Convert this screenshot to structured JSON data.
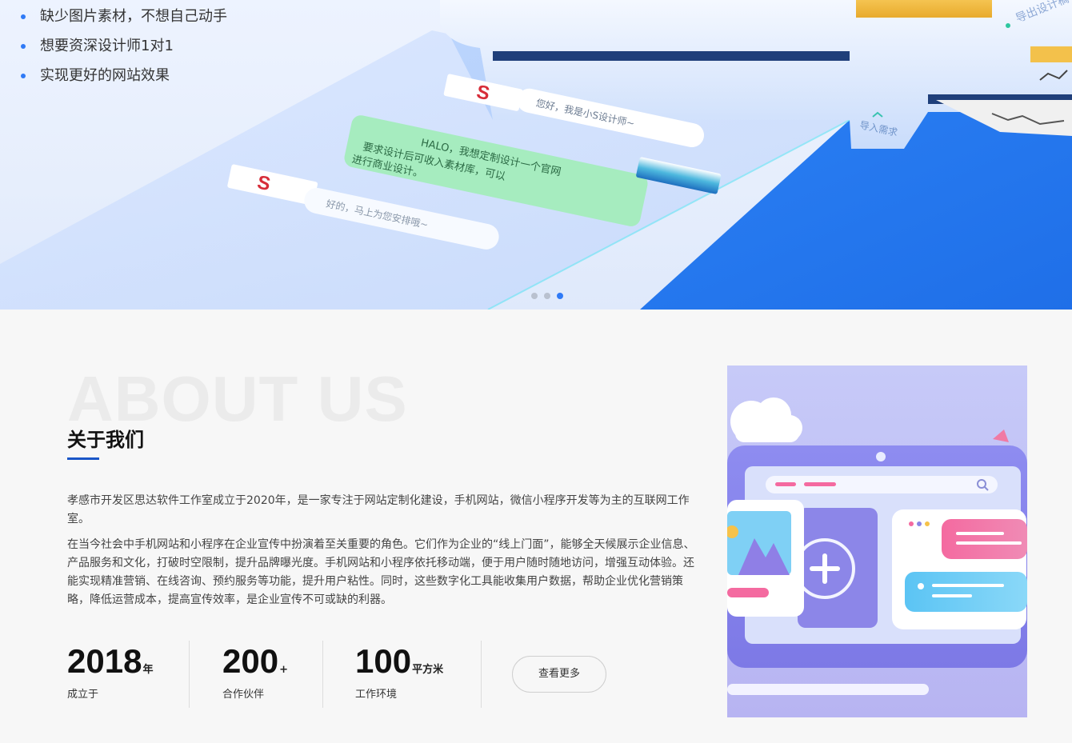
{
  "hero": {
    "bullets": [
      "缺少图片素材，不想自己动手",
      "想要资深设计师1对1",
      "实现更好的网站效果"
    ],
    "printer_import_label": "导入需求",
    "printer_export_label": "导出设计稿",
    "chat_bubble_1": "您好，我是小S设计师~",
    "chat_bubble_2": "HALO，我想定制设计一个官网 要求设计后可收入素材库，可以 进行商业设计。",
    "chat_bubble_3": "好的，马上为您安排哦~",
    "logo_letter": "S",
    "dots": [
      {
        "active": false
      },
      {
        "active": false
      },
      {
        "active": true
      }
    ]
  },
  "about": {
    "watermark": "ABOUT US",
    "title": "关于我们",
    "paragraph_1": "孝感市开发区思达软件工作室成立于2020年，是一家专注于网站定制化建设，手机网站，微信小程序开发等为主的互联网工作室。",
    "paragraph_2": "在当今社会中手机网站和小程序在企业宣传中扮演着至关重要的角色。它们作为企业的“线上门面”，能够全天候展示企业信息、产品服务和文化，打破时空限制，提升品牌曝光度。手机网站和小程序依托移动端，便于用户随时随地访问，增强互动体验。还能实现精准营销、在线咨询、预约服务等功能，提升用户粘性。同时，这些数字化工具能收集用户数据，帮助企业优化营销策略，降低运营成本，提高宣传效率，是企业宣传不可或缺的利器。",
    "stats": [
      {
        "value": "2018",
        "unit": "年",
        "label": "成立于"
      },
      {
        "value": "200",
        "unit": "+",
        "label": "合作伙伴"
      },
      {
        "value": "100",
        "unit": "平方米",
        "label": "工作环境"
      }
    ],
    "more_button": "查看更多"
  },
  "colors": {
    "accent": "#2f7af6",
    "title_underline": "#1a56c7",
    "hero_blue": "#2a7ff3"
  }
}
